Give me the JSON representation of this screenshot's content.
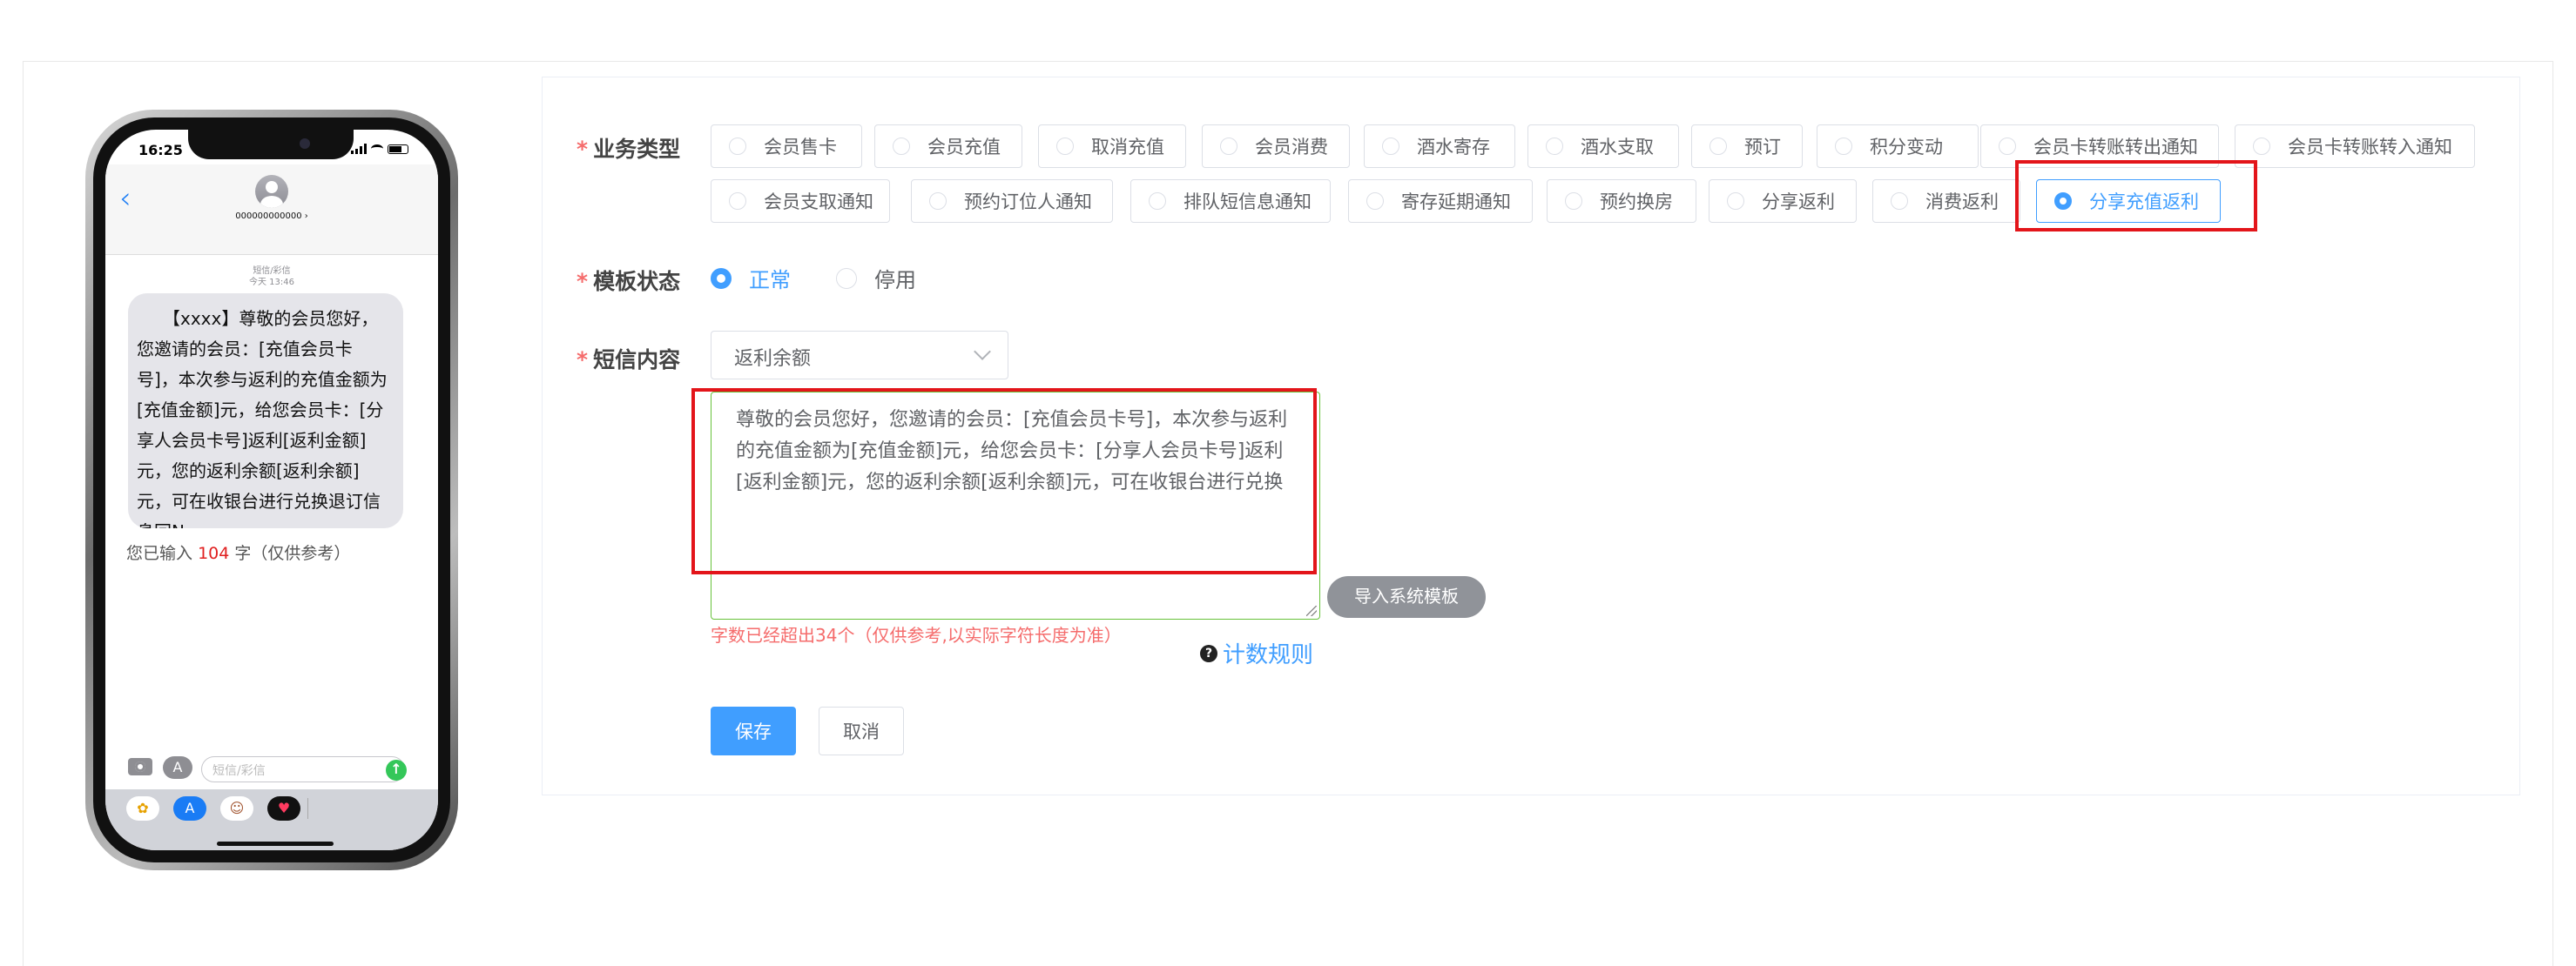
{
  "phone": {
    "status_time": "16:25",
    "contact_number": "000000000000 ›",
    "meta_line1": "短信/彩信",
    "meta_line2": "今天 13:46",
    "bubble_text": "【xxxx】尊敬的会员您好，您邀请的会员：[充值会员卡号]，本次参与返利的充值金额为[充值金额]元，给您会员卡：[分享人会员卡号]返利[返利金额]元，您的返利余额[返利余额]元，可在收银台进行兑换退订信息回N",
    "count_prefix": "您已输入",
    "count_value": "104",
    "count_suffix": "字（仅供参考）",
    "input_placeholder": "短信/彩信",
    "icons": [
      "back-chevron-icon",
      "avatar-icon",
      "camera-icon",
      "app-store-icon",
      "send-arrow-icon",
      "photos-icon",
      "memoji-icon",
      "heart-icon"
    ]
  },
  "form": {
    "business_type": {
      "label": "业务类型",
      "options": [
        "会员售卡",
        "会员充值",
        "取消充值",
        "会员消费",
        "酒水寄存",
        "酒水支取",
        "预订",
        "积分变动",
        "会员卡转账转出通知",
        "会员卡转账转入通知",
        "会员支取通知",
        "预约订位人通知",
        "排队短信息通知",
        "寄存延期通知",
        "预约换房",
        "分享返利",
        "消费返利",
        "分享充值返利"
      ],
      "selected": "分享充值返利"
    },
    "template_status": {
      "label": "模板状态",
      "options": [
        "正常",
        "停用"
      ],
      "selected": "正常"
    },
    "sms_content": {
      "label": "短信内容",
      "variable_select": "返利余额",
      "text": "尊敬的会员您好，您邀请的会员：[充值会员卡号]，本次参与返利的充值金额为[充值金额]元，给您会员卡：[分享人会员卡号]返利[返利金额]元，您的返利余额[返利余额]元，可在收银台进行兑换",
      "import_button": "导入系统模板",
      "warning": "字数已经超出34个（仅供参考,以实际字符长度为准）",
      "rules_link": "计数规则"
    },
    "save_button": "保存",
    "cancel_button": "取消"
  },
  "colors": {
    "primary": "#409eff",
    "danger": "#f56c6c",
    "highlight": "#e3151a",
    "valid_border": "#67c23a"
  }
}
